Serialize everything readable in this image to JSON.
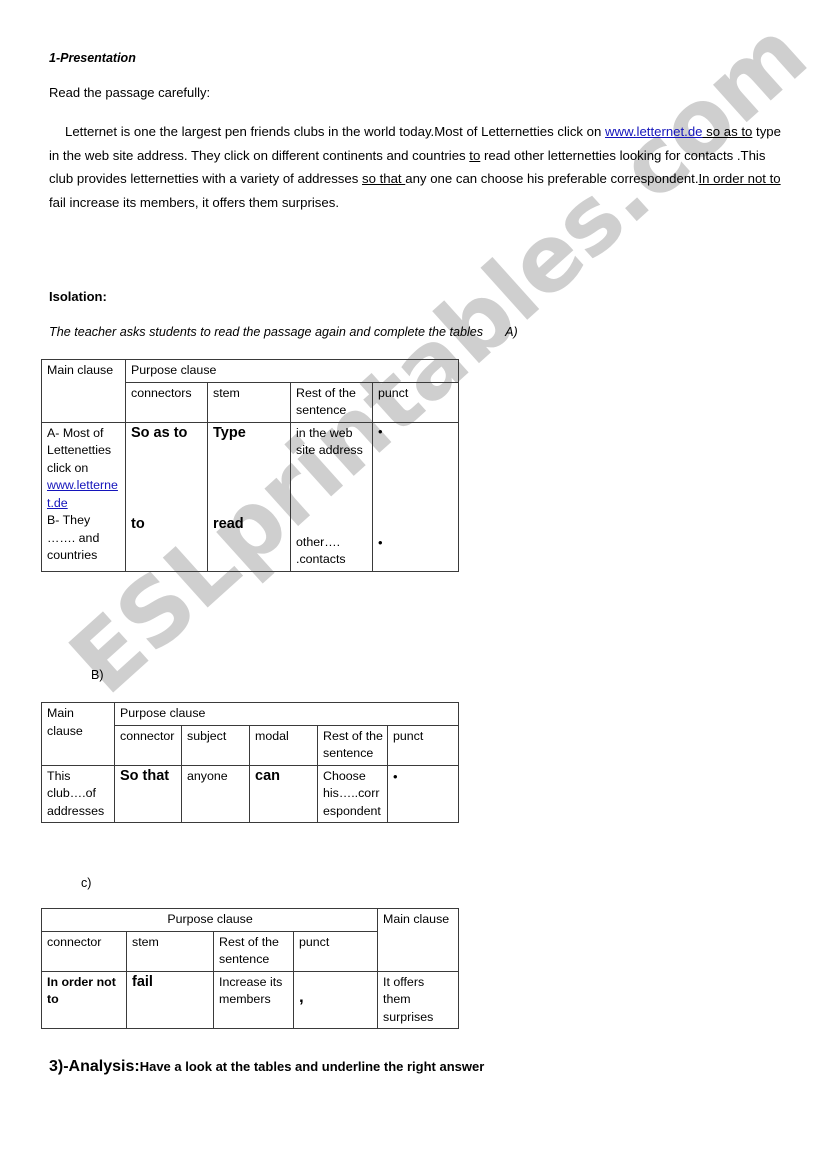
{
  "document": {
    "presentation_heading": "1-Presentation",
    "read_instruction": "Read the passage carefully:",
    "passage": {
      "part1": "Letternet is one the largest pen friends clubs in the world today.Most of Letternetties click on ",
      "link": "www.letternet.de",
      "conn1": " so as to",
      "part2": " type in the web site address. They click on different continents and countries ",
      "conn2": "to",
      "part3": " read other letternetties looking for contacts .This club provides letternetties with a variety of addresses ",
      "conn3": "so that ",
      "part4": "any one can choose his preferable correspondent.",
      "conn4": "In order not to ",
      "part5": "fail increase its members, it offers them surprises."
    },
    "isolation_heading": "Isolation:",
    "instruction": "The teacher asks students to read the passage again and complete the tables",
    "label_a": "A)",
    "label_b": "B)",
    "label_c": "c)",
    "analysis": {
      "title": "3)-Analysis:",
      "text": "Have a look at the tables and underline the right answer"
    },
    "watermark": "ESLprintables.com",
    "colors": {
      "link": "#1414bb",
      "border": "#3a3a3a",
      "watermark": "#cfcfcf",
      "text": "#000000"
    }
  },
  "tableA": {
    "headers": {
      "main_clause": "Main clause",
      "purpose_clause": "Purpose clause",
      "connectors": "connectors",
      "stem": "stem",
      "rest": "Rest of the sentence",
      "punct": "punct"
    },
    "row": {
      "main_clause_a": "A- Most of Lettenetties click on ",
      "main_clause_link": "www.letternet.de",
      "main_clause_b": "B- They ……. and countries",
      "connector1": "So as to",
      "stem1": "Type",
      "rest1": "in the web site address",
      "punct1": "•",
      "connector2": "to",
      "stem2": "read",
      "rest2": "other…. .contacts",
      "punct2": "•"
    }
  },
  "tableB": {
    "headers": {
      "main_clause": "Main clause",
      "purpose_clause": "Purpose clause",
      "connector": "connector",
      "subject": "subject",
      "modal": "modal",
      "rest": "Rest of the sentence",
      "punct": "punct"
    },
    "row": {
      "main_clause": "This club….of addresses",
      "connector": "So that",
      "subject": "anyone",
      "modal": "can",
      "rest": "Choose his…..correspondent",
      "punct": "•"
    }
  },
  "tableC": {
    "headers": {
      "purpose_clause": "Purpose clause",
      "main_clause": "Main clause",
      "connector": "connector",
      "stem": "stem",
      "rest": "Rest of the sentence",
      "punct": "punct"
    },
    "row": {
      "connector": "In order not to",
      "stem": "fail",
      "rest": "Increase its members",
      "punct": ",",
      "main_clause": "It offers them surprises"
    }
  }
}
